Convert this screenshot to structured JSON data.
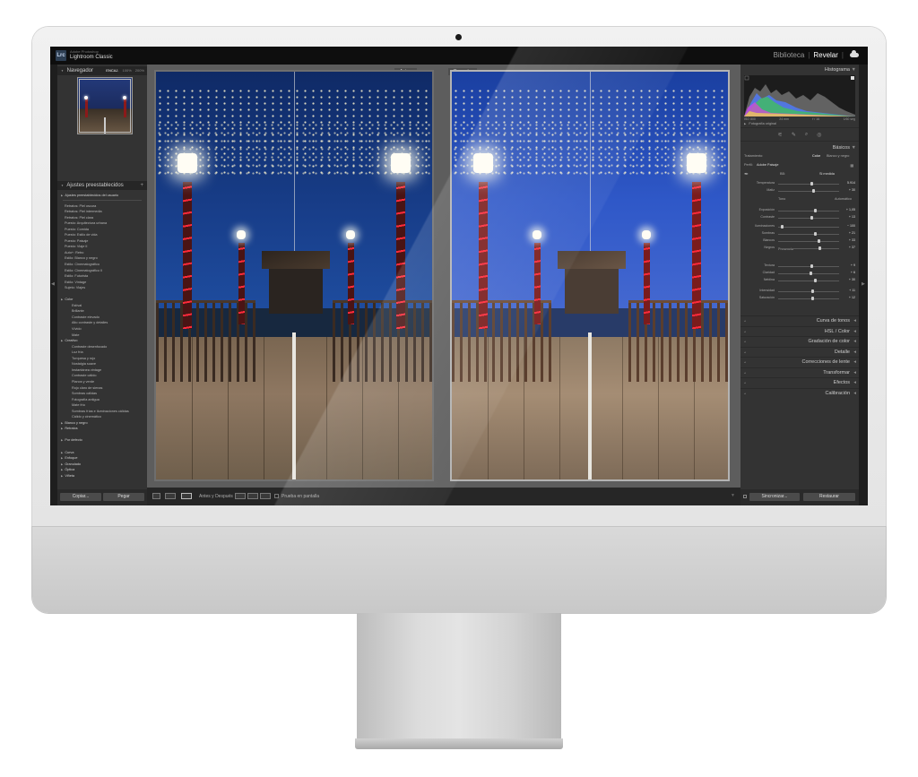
{
  "app": {
    "logo": "Lrc",
    "subtitle": "Adobe Photoshop",
    "name": "Lightroom Classic",
    "modules": [
      "Biblioteca",
      "Revelar"
    ],
    "active_module": "Revelar"
  },
  "navigator": {
    "title": "Navegador",
    "tabs": [
      "ENCAJ.",
      "100%",
      "200%"
    ]
  },
  "presets": {
    "title": "Ajustes preestablecidos",
    "items": [
      {
        "label": "Ajustes preestablecidos del usuario",
        "kind": "folder"
      },
      {
        "label": "",
        "kind": "line"
      },
      {
        "label": "Retratos: Piel oscura",
        "kind": "item"
      },
      {
        "label": "Retratos: Piel intermedia",
        "kind": "item"
      },
      {
        "label": "Retratos: Piel clara",
        "kind": "item"
      },
      {
        "label": "Puesto: Arquitectura urbana",
        "kind": "item"
      },
      {
        "label": "Puesto: Comida",
        "kind": "item"
      },
      {
        "label": "Puesto: Estilo de vida",
        "kind": "item"
      },
      {
        "label": "Puesto: Paisaje",
        "kind": "item"
      },
      {
        "label": "Puesto: Viaje II",
        "kind": "item"
      },
      {
        "label": "Auto+: Retro",
        "kind": "item"
      },
      {
        "label": "Estilo: Blanco y negro",
        "kind": "item"
      },
      {
        "label": "Estilo: Cinematográfico",
        "kind": "item"
      },
      {
        "label": "Estilo: Cinematográfico II",
        "kind": "item"
      },
      {
        "label": "Estilo: Futurista",
        "kind": "item"
      },
      {
        "label": "Estilo: Vintage",
        "kind": "item"
      },
      {
        "label": "Sujeto: Viajes",
        "kind": "item"
      },
      {
        "label": "",
        "kind": "gap"
      },
      {
        "label": "Color",
        "kind": "folder"
      },
      {
        "label": "Estival",
        "kind": "sub"
      },
      {
        "label": "Brillante",
        "kind": "sub"
      },
      {
        "label": "Contraste elevado",
        "kind": "sub"
      },
      {
        "label": "Alto contraste y detalles",
        "kind": "sub"
      },
      {
        "label": "Vívido",
        "kind": "sub"
      },
      {
        "label": "Mate",
        "kind": "sub"
      },
      {
        "label": "Creativo",
        "kind": "folder"
      },
      {
        "label": "Contraste desenfocado",
        "kind": "sub"
      },
      {
        "label": "Luz fría",
        "kind": "sub"
      },
      {
        "label": "Turquesa y rojo",
        "kind": "sub"
      },
      {
        "label": "Nostalgia suave",
        "kind": "sub"
      },
      {
        "label": "Instantánea vintage",
        "kind": "sub"
      },
      {
        "label": "Contraste cálido",
        "kind": "sub"
      },
      {
        "label": "Planos y verde",
        "kind": "sub"
      },
      {
        "label": "Rojo claro de sienas",
        "kind": "sub"
      },
      {
        "label": "Sombras cálidas",
        "kind": "sub"
      },
      {
        "label": "Fotografía antigua",
        "kind": "sub"
      },
      {
        "label": "Mate frío",
        "kind": "sub"
      },
      {
        "label": "Sombras frías e iluminaciones cálidas",
        "kind": "sub"
      },
      {
        "label": "Cálido y cinemático",
        "kind": "sub"
      },
      {
        "label": "Blanco y negro",
        "kind": "folder"
      },
      {
        "label": "Retratos",
        "kind": "folder"
      },
      {
        "label": "",
        "kind": "gap"
      },
      {
        "label": "Por defecto",
        "kind": "folder"
      },
      {
        "label": "",
        "kind": "gap"
      },
      {
        "label": "Curva",
        "kind": "folder"
      },
      {
        "label": "Enfoque",
        "kind": "folder"
      },
      {
        "label": "Granulado",
        "kind": "folder"
      },
      {
        "label": "Óptica",
        "kind": "folder"
      },
      {
        "label": "Viñeta",
        "kind": "folder"
      }
    ]
  },
  "left_buttons": {
    "copy": "Copiar...",
    "paste": "Pegar"
  },
  "compare": {
    "before_label": "Antes",
    "after_label": "Después"
  },
  "toolbar": {
    "mode": "Antes y Después",
    "soft_proof": "Prueba en pantalla"
  },
  "histogram": {
    "title": "Histograma",
    "readouts": [
      "ISO 800",
      "24 mm",
      "f / 16",
      "1/60 seg"
    ],
    "original_photo": "Fotografía original"
  },
  "basic": {
    "title": "Básicos",
    "treatment_label": "Tratamiento:",
    "treatment_options": [
      "Color",
      "Blanco y negro"
    ],
    "profile_label": "Perfil:",
    "profile_value": "Adobe Paisaje",
    "wb_label": "BB:",
    "wb_value": "Si medida",
    "tone_label": "Tono",
    "tone_auto": "Automático",
    "presence_label": "Presencia",
    "sliders": [
      {
        "label": "Temperatura",
        "value": "5.914",
        "pos": 0.55
      },
      {
        "label": "Matiz",
        "value": "+ 30",
        "pos": 0.58
      },
      {
        "label": "Exposición",
        "value": "+ 1,05",
        "pos": 0.6
      },
      {
        "label": "Contraste",
        "value": "+ 13",
        "pos": 0.55
      },
      {
        "label": "Iluminaciones",
        "value": "− 100",
        "pos": 0.05
      },
      {
        "label": "Sombras",
        "value": "+ 21",
        "pos": 0.6
      },
      {
        "label": "Blancos",
        "value": "+ 33",
        "pos": 0.66
      },
      {
        "label": "Negros",
        "value": "+ 37",
        "pos": 0.68
      },
      {
        "label": "Textura",
        "value": "+ 9",
        "pos": 0.54
      },
      {
        "label": "Claridad",
        "value": "+ 6",
        "pos": 0.53
      },
      {
        "label": "Neblina",
        "value": "+ 30",
        "pos": 0.6
      },
      {
        "label": "Intensidad",
        "value": "+ 11",
        "pos": 0.56
      },
      {
        "label": "Saturación",
        "value": "+ 12",
        "pos": 0.56
      }
    ]
  },
  "panels": [
    "Curva de tonos",
    "HSL / Color",
    "Gradación de color",
    "Detalle",
    "Correcciones de lente",
    "Transformar",
    "Efectos",
    "Calibración"
  ],
  "right_buttons": {
    "sync": "Sincronizar...",
    "reset": "Restaurar"
  },
  "colors": {
    "panel": "#333333",
    "dark": "#1e1e1e",
    "accent_red": "#ff2a3a"
  }
}
